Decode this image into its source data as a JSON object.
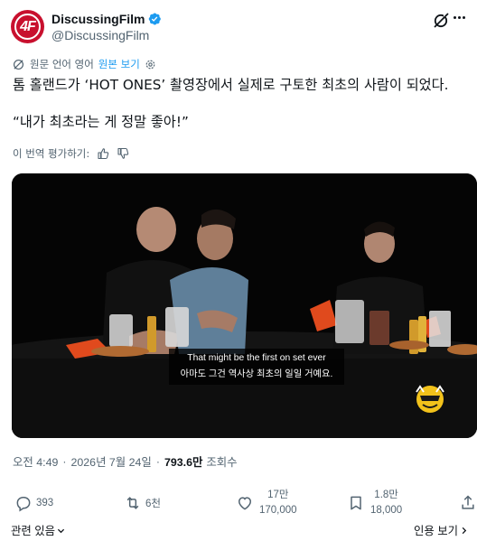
{
  "author": {
    "display_name": "DiscussingFilm",
    "handle": "@DiscussingFilm",
    "avatar_icon": "discussingfilm-logo",
    "verified": true,
    "accent": "#c8102e",
    "verified_color": "#1d9bf0"
  },
  "translation": {
    "source_note": "원문 언어 영어",
    "view_original": "원본 보기",
    "rate_label": "이 번역 평가하기:"
  },
  "tweet": {
    "text": "톰 홀랜드가 ‘HOT ONES’ 촬영장에서 실제로 구토한 최초의 사람이 되었다.",
    "quote": "“내가 최초라는 게 정말 좋아!”"
  },
  "media": {
    "caption_en": "That might be the first on set ever",
    "caption_ko": "아마도 그건 역사상 최초의 일일 거예요.",
    "watermark_icon": "hot-ones-logo"
  },
  "meta": {
    "time": "오전 4:49",
    "date": "2026년 7월 24일",
    "separator": "·",
    "views_count": "793.6만",
    "views_label": "조회수"
  },
  "actions": {
    "reply_count": "393",
    "retweet_count": "6천",
    "like_top": "17만",
    "like_bottom": "170,000",
    "bookmark_top": "1.8만",
    "bookmark_bottom": "18,000"
  },
  "footer": {
    "related": "관련 있음",
    "quotes": "인용 보기"
  },
  "colors": {
    "text": "#0f1419",
    "secondary": "#536471",
    "link": "#1d9bf0"
  }
}
